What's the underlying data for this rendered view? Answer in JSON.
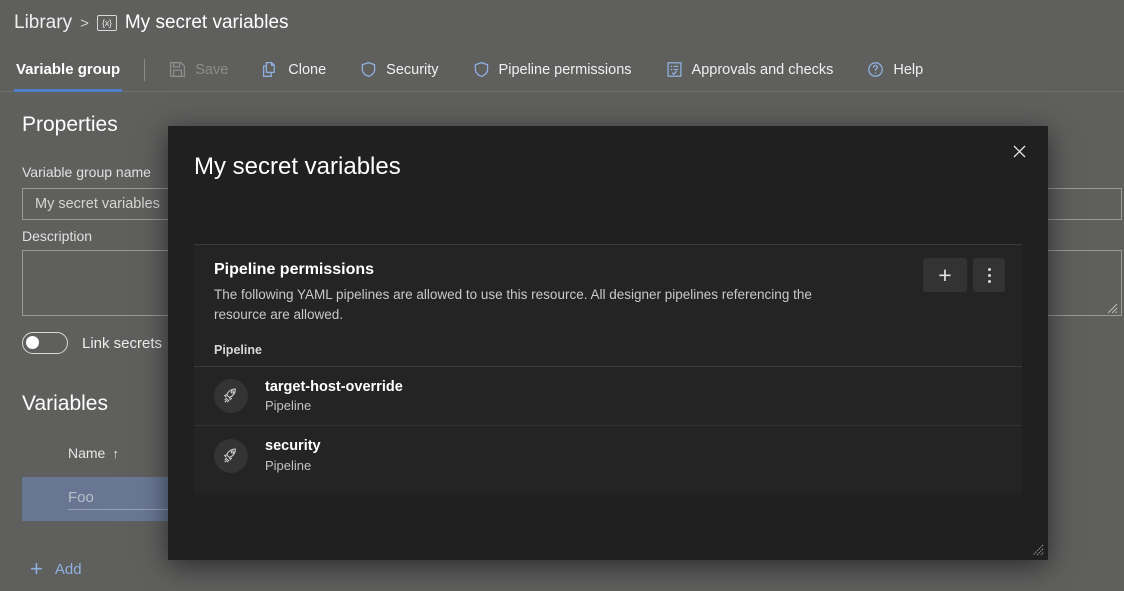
{
  "breadcrumb": {
    "root_label": "Library",
    "separator": ">",
    "group_icon": "variable-group-icon",
    "icon_glyph": "{x}",
    "current_label": "My secret variables"
  },
  "toolbar": {
    "active_tab": "Variable group",
    "buttons": [
      {
        "label": "Save",
        "icon": "save-icon",
        "disabled": true
      },
      {
        "label": "Clone",
        "icon": "clone-icon",
        "disabled": false
      },
      {
        "label": "Security",
        "icon": "shield-icon",
        "disabled": false
      },
      {
        "label": "Pipeline permissions",
        "icon": "shield-icon",
        "disabled": false
      },
      {
        "label": "Approvals and checks",
        "icon": "checklist-icon",
        "disabled": false
      },
      {
        "label": "Help",
        "icon": "help-circle-icon",
        "disabled": false
      }
    ],
    "accent_color": "#4f7fc4"
  },
  "properties": {
    "heading": "Properties",
    "name_label": "Variable group name",
    "name_value": "My secret variables",
    "description_label": "Description",
    "description_value": "",
    "link_secrets_label": "Link secrets",
    "link_secrets_on": false
  },
  "variables": {
    "heading": "Variables",
    "column_header": "Name",
    "sort_arrow": "↑",
    "rows": [
      {
        "name": "Foo"
      }
    ],
    "add_label": "Add",
    "add_icon": "plus-icon",
    "row_highlight_color": "#677693"
  },
  "dialog": {
    "title": "My secret variables",
    "close_icon": "close-icon",
    "resize_grip_icon": "resize-grip-icon",
    "background_color": "#202020",
    "card": {
      "title": "Pipeline permissions",
      "description": "The following YAML pipelines are allowed to use this resource. All designer pipelines referencing the resource are allowed.",
      "add_icon": "plus-icon",
      "more_icon": "kebab-menu-icon",
      "column_header": "Pipeline",
      "rows": [
        {
          "name": "target-host-override",
          "type": "Pipeline",
          "icon": "rocket-icon"
        },
        {
          "name": "security",
          "type": "Pipeline",
          "icon": "rocket-icon"
        }
      ]
    }
  }
}
